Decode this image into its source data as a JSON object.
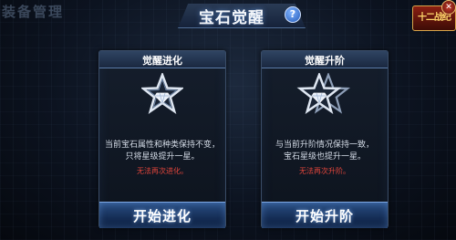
{
  "header": {
    "background_label": "装备管理",
    "title": "宝石觉醒",
    "help_icon": "question-mark-icon",
    "help_glyph": "?",
    "logo_text": "十二战纪",
    "close_icon": "close-icon"
  },
  "cards": [
    {
      "title": "觉醒进化",
      "icon": "single-star-gem-icon",
      "description_line1": "当前宝石属性和种类保持不变，",
      "description_line2": "只将星级提升一星。",
      "warning": "无法再次进化。",
      "button_label": "开始进化"
    },
    {
      "title": "觉醒升阶",
      "icon": "double-star-gem-icon",
      "description_line1": "与当前升阶情况保持一致，",
      "description_line2": "宝石星级也提升一星。",
      "warning": "无法再次升阶。",
      "button_label": "开始升阶"
    }
  ],
  "colors": {
    "accent_blue": "#2a4f85",
    "warning_red": "#e2453b",
    "panel_border": "#3a4d68"
  }
}
